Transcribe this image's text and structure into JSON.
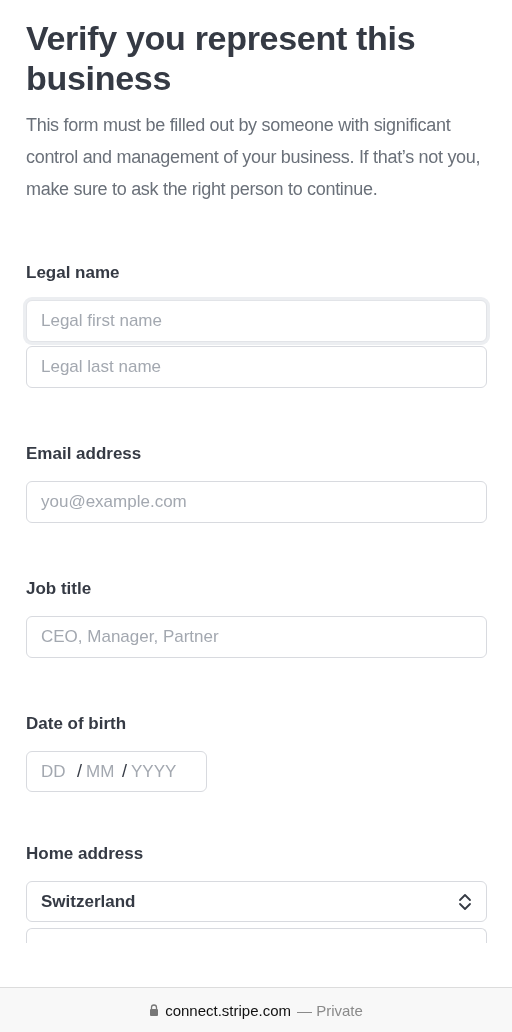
{
  "heading": "Verify you represent this business",
  "intro": "This form must be filled out by someone with significant control and management of your business. If that’s not you, make sure to ask the right person to continue.",
  "sections": [
    {
      "kind": "text",
      "label": "Legal name",
      "fields": [
        {
          "placeholder": "Legal first name",
          "focused": true
        },
        {
          "placeholder": "Legal last name",
          "focused": false
        }
      ]
    },
    {
      "kind": "text",
      "label": "Email address",
      "fields": [
        {
          "placeholder": "you@example.com",
          "focused": false
        }
      ]
    },
    {
      "kind": "text",
      "label": "Job title",
      "fields": [
        {
          "placeholder": "CEO, Manager, Partner",
          "focused": false
        }
      ]
    },
    {
      "kind": "date",
      "label": "Date of birth",
      "parts": [
        {
          "placeholder": "DD"
        },
        {
          "separator": "/",
          "placeholder": "MM"
        },
        {
          "separator": "/",
          "placeholder": "YYYY"
        }
      ]
    },
    {
      "kind": "address",
      "label": "Home address",
      "country": "Switzerland",
      "fields": [
        {
          "focused": false
        }
      ]
    }
  ],
  "browser_bar": {
    "url": "connect.stripe.com",
    "suffix": "— Private"
  }
}
